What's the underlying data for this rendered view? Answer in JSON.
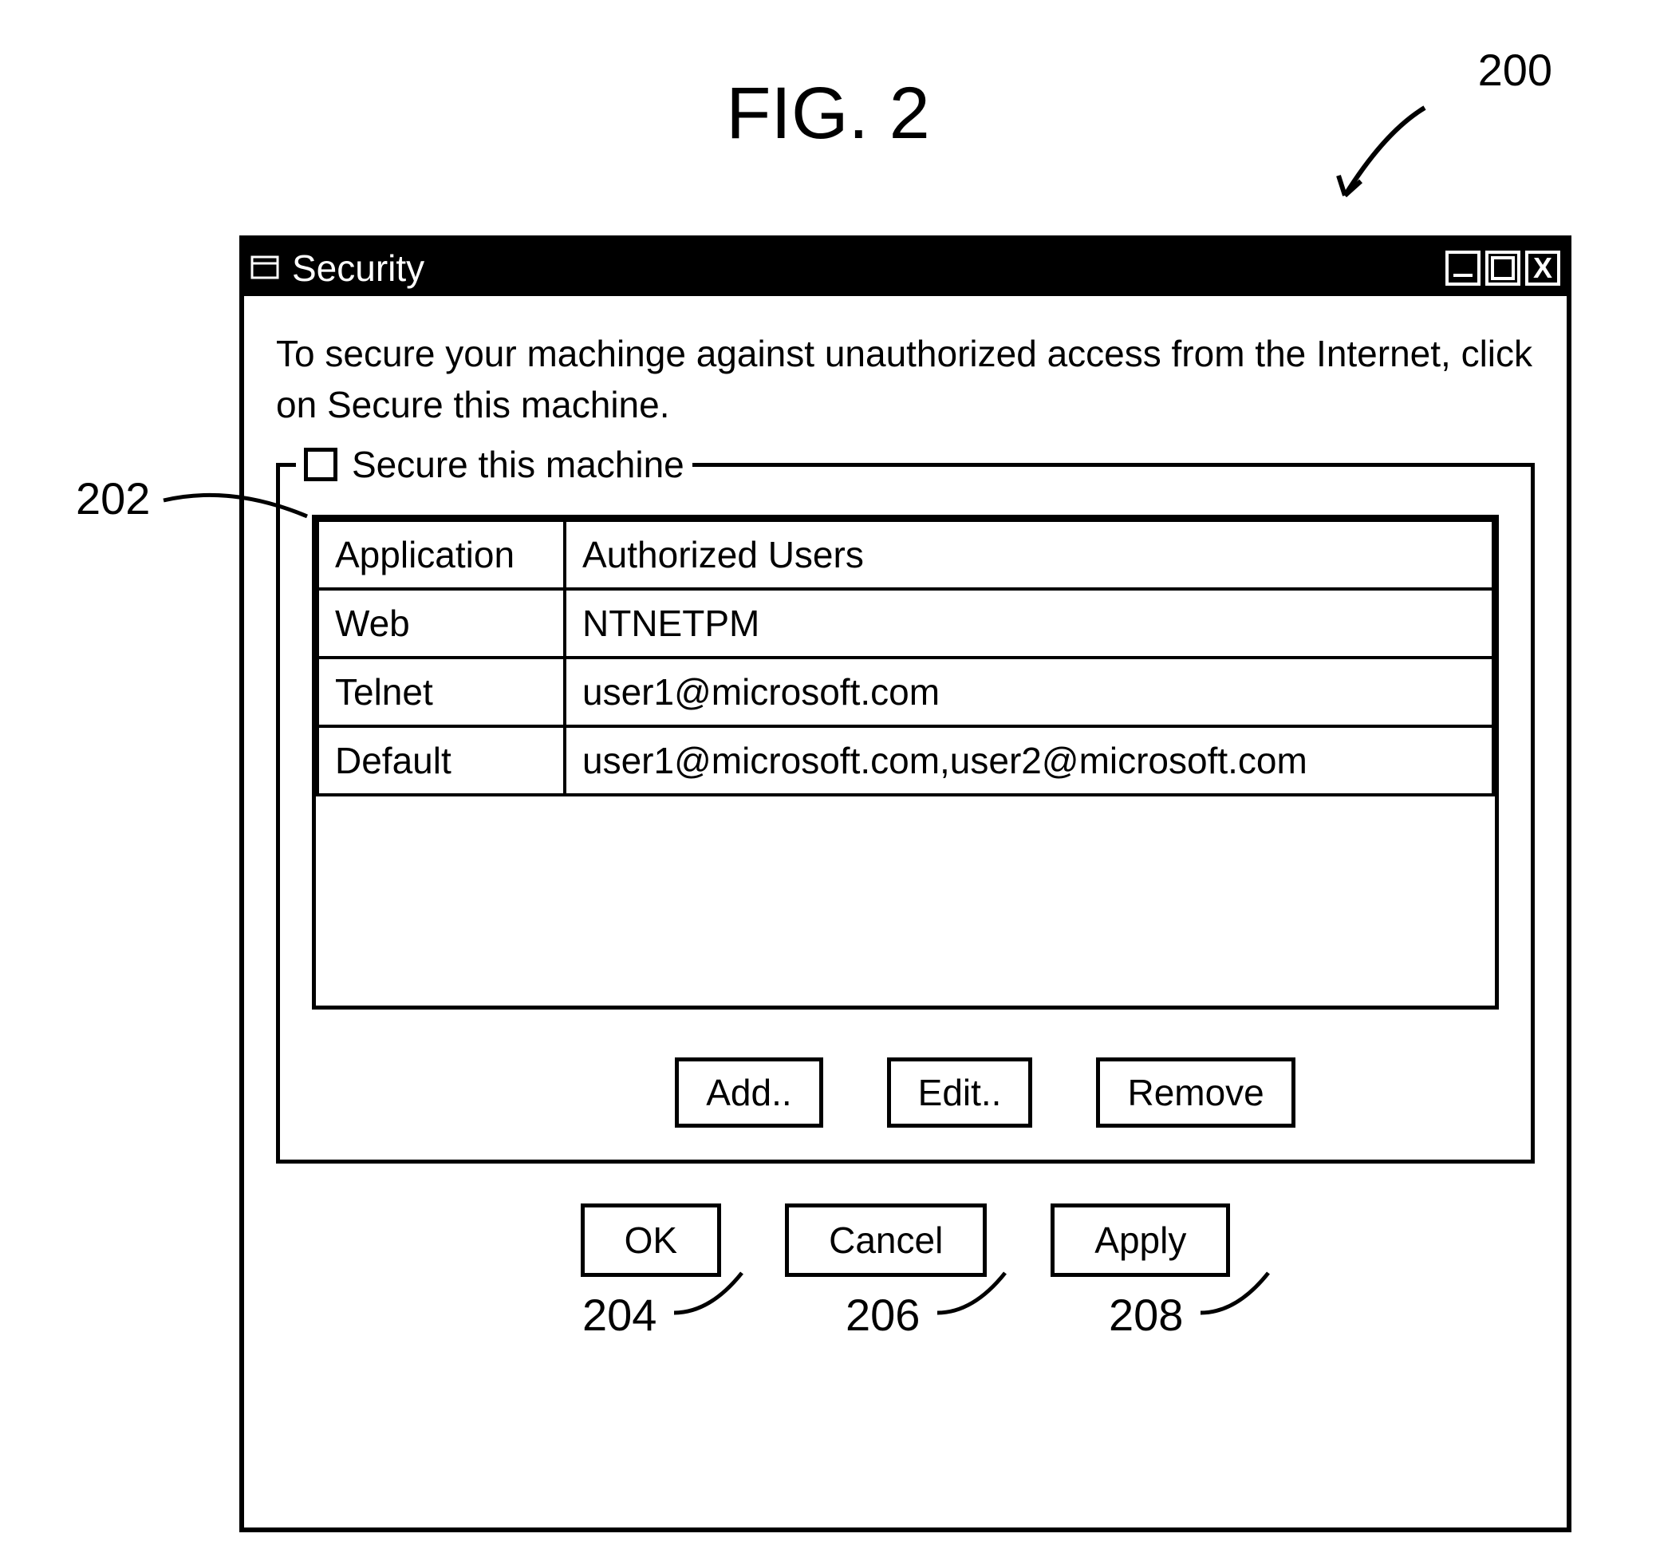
{
  "figure": {
    "label": "FIG. 2",
    "ref_main": "200",
    "refs": {
      "checkbox": "202",
      "add": "204",
      "edit": "206",
      "remove": "208"
    }
  },
  "window": {
    "title": "Security",
    "instruction": "To secure your machinge against unauthorized access from the Internet, click on Secure this machine.",
    "groupbox_label": "Secure this machine",
    "table": {
      "headers": {
        "col1": "Application",
        "col2": "Authorized Users"
      },
      "rows": [
        {
          "app": "Web",
          "users": "NTNETPM"
        },
        {
          "app": "Telnet",
          "users": "user1@microsoft.com"
        },
        {
          "app": "Default",
          "users": "user1@microsoft.com,user2@microsoft.com"
        }
      ]
    },
    "group_buttons": {
      "add": "Add..",
      "edit": "Edit..",
      "remove": "Remove"
    },
    "dialog_buttons": {
      "ok": "OK",
      "cancel": "Cancel",
      "apply": "Apply"
    }
  }
}
